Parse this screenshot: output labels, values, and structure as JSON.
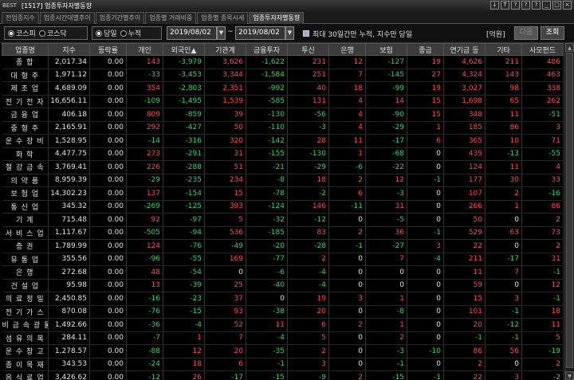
{
  "window": {
    "logo": "BEST",
    "title": "[1517] 업종투자자별동향",
    "controls": [
      "↓",
      "T",
      "?",
      "?",
      "?",
      "_",
      "□",
      "×"
    ]
  },
  "tabs": [
    {
      "label": "전업종지수",
      "active": false
    },
    {
      "label": "업종시간대별추이",
      "active": false
    },
    {
      "label": "업종기간별추이",
      "active": false
    },
    {
      "label": "업종별 거래비중",
      "active": false
    },
    {
      "label": "업종별 종목시세",
      "active": false
    },
    {
      "label": "업종투자자별동향",
      "active": true
    }
  ],
  "toolbar": {
    "market": [
      {
        "label": "코스피",
        "selected": true
      },
      {
        "label": "코스닥",
        "selected": false
      }
    ],
    "period": [
      {
        "label": "당일",
        "selected": true
      },
      {
        "label": "누적",
        "selected": false
      }
    ],
    "start_date": "2019/08/02",
    "end_date": "2019/08/02",
    "date_separator": "~",
    "note": "최대 30일간만 누적, 지수만 당일",
    "unit": "[억원]",
    "next_button": "다음",
    "query_button": "조회"
  },
  "table": {
    "headers": [
      "업종명",
      "지수",
      "등락률",
      "개인",
      "외국인▲",
      "기관계",
      "금융투자",
      "투신",
      "은행",
      "보험",
      "종금",
      "연기금 등",
      "기타",
      "사모펀드"
    ],
    "rows": [
      [
        "종 합",
        "2,017.34",
        "0.00",
        "143",
        "-3,979",
        "3,626",
        "-1,622",
        "231",
        "12",
        "-127",
        "19",
        "4,626",
        "211",
        "486"
      ],
      [
        "대 형 주",
        "1,971.12",
        "0.00",
        "-33",
        "-3,453",
        "3,344",
        "-1,584",
        "251",
        "7",
        "-145",
        "27",
        "4,324",
        "143",
        "463"
      ],
      [
        "제 조 업",
        "4,689.09",
        "0.00",
        "354",
        "-2,803",
        "2,351",
        "-992",
        "40",
        "18",
        "-99",
        "19",
        "3,027",
        "98",
        "338"
      ],
      [
        "전 기 전 자",
        "16,656.11",
        "0.00",
        "-109",
        "-1,495",
        "1,539",
        "-585",
        "131",
        "4",
        "14",
        "15",
        "1,698",
        "65",
        "262"
      ],
      [
        "금 융 업",
        "406.18",
        "0.00",
        "809",
        "-859",
        "39",
        "-130",
        "-56",
        "4",
        "-90",
        "15",
        "348",
        "11",
        "-51"
      ],
      [
        "중 형 주",
        "2,165.91",
        "0.00",
        "292",
        "-427",
        "50",
        "-110",
        "-3",
        "4",
        "-29",
        "1",
        "185",
        "86",
        "3"
      ],
      [
        "운 수 장 비",
        "1,528.95",
        "0.00",
        "-14",
        "-316",
        "320",
        "-142",
        "28",
        "11",
        "-17",
        "6",
        "365",
        "10",
        "71"
      ],
      [
        "화 학",
        "4,477.75",
        "0.00",
        "273",
        "-291",
        "31",
        "-155",
        "-130",
        "1",
        "-68",
        "0",
        "439",
        "-13",
        "-55"
      ],
      [
        "철 강 금 속",
        "3,769.41",
        "0.00",
        "226",
        "-288",
        "51",
        "-21",
        "-29",
        "-6",
        "-22",
        "0",
        "124",
        "11",
        "4"
      ],
      [
        "의 약 품",
        "8,959.39",
        "0.00",
        "-29",
        "-235",
        "234",
        "-8",
        "18",
        "2",
        "12",
        "-1",
        "177",
        "30",
        "33"
      ],
      [
        "보 험 업",
        "14,302.23",
        "0.00",
        "137",
        "-154",
        "15",
        "-78",
        "-2",
        "6",
        "-3",
        "0",
        "107",
        "2",
        "-16"
      ],
      [
        "통 신 업",
        "345.32",
        "0.00",
        "-269",
        "-125",
        "393",
        "-124",
        "146",
        "-11",
        "31",
        "0",
        "266",
        "1",
        "86"
      ],
      [
        "기 계",
        "715.48",
        "0.00",
        "92",
        "-97",
        "5",
        "-32",
        "-12",
        "0",
        "-5",
        "0",
        "50",
        "0",
        "2"
      ],
      [
        "서 비 스 업",
        "1,117.67",
        "0.00",
        "-505",
        "-94",
        "536",
        "-185",
        "83",
        "2",
        "36",
        "-1",
        "529",
        "63",
        "73"
      ],
      [
        "증 권",
        "1,789.99",
        "0.00",
        "124",
        "-76",
        "-49",
        "-20",
        "-28",
        "-1",
        "-27",
        "3",
        "22",
        "0",
        "2"
      ],
      [
        "유 통 업",
        "355.56",
        "0.00",
        "-96",
        "-55",
        "169",
        "-77",
        "2",
        "0",
        "7",
        "-4",
        "211",
        "-17",
        "31"
      ],
      [
        "은 행",
        "272.68",
        "0.00",
        "48",
        "-54",
        "0",
        "-6",
        "-4",
        "0",
        "0",
        "0",
        "11",
        "7",
        "-1"
      ],
      [
        "건 설 업",
        "95.98",
        "0.00",
        "13",
        "-39",
        "25",
        "-40",
        "-4",
        "0",
        "0",
        "0",
        "59",
        "0",
        "12"
      ],
      [
        "의 료 정 밀",
        "2,450.85",
        "0.00",
        "-16",
        "-23",
        "37",
        "0",
        "19",
        "3",
        "1",
        "0",
        "15",
        "3",
        "-1"
      ],
      [
        "전 기 가 스",
        "870.08",
        "0.00",
        "-76",
        "-15",
        "93",
        "-38",
        "20",
        "0",
        "-8",
        "0",
        "101",
        "-1",
        "18"
      ],
      [
        "비 금 속 광 물",
        "1,492.66",
        "0.00",
        "-36",
        "-4",
        "52",
        "11",
        "6",
        "2",
        "1",
        "0",
        "20",
        "-12",
        "11"
      ],
      [
        "섬 유 의 복",
        "284.11",
        "0.00",
        "-7",
        "1",
        "7",
        "-4",
        "5",
        "0",
        "2",
        "0",
        "-1",
        "-1",
        "5"
      ],
      [
        "운 수 창 고",
        "1,278.57",
        "0.00",
        "-88",
        "12",
        "20",
        "-35",
        "2",
        "0",
        "-3",
        "-10",
        "86",
        "56",
        "-19"
      ],
      [
        "종 이 목 재",
        "343.53",
        "0.00",
        "-24",
        "18",
        "6",
        "-1",
        "3",
        "0",
        "-1",
        "0",
        "2",
        "0",
        "2"
      ],
      [
        "음 식 료 업",
        "3,426.62",
        "0.00",
        "-12",
        "26",
        "-17",
        "-15",
        "-9",
        "2",
        "-15",
        "-1",
        "22",
        "3",
        "-2"
      ],
      [
        "소 형 주",
        "1,798.65",
        "0.00",
        "-113",
        "104",
        "23",
        "7",
        "11",
        "2",
        "-5",
        "-10",
        "23",
        "-15",
        "-5"
      ]
    ]
  },
  "colors": {
    "positive": "#ff4a4a",
    "negative": "#2ed36a",
    "neutral": "#e6e6e6",
    "header_bg": "#3c3c3c",
    "active_tab_bg": "#3d3d3d"
  }
}
